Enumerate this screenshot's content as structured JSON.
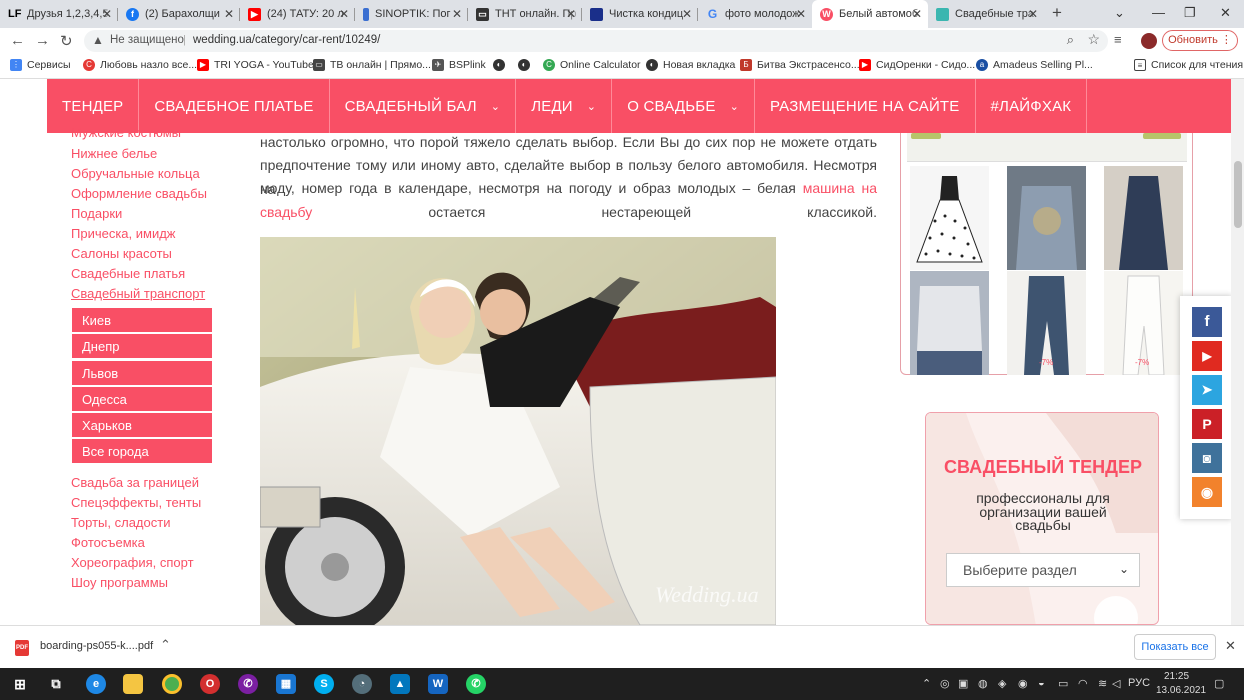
{
  "browser": {
    "tabs": [
      {
        "label": "Друзья 1,2,3,4,5",
        "icon": "LF",
        "color": "#000000"
      },
      {
        "label": "(2) Барахолщи",
        "icon": "facebook-icon",
        "color": "#1877f2"
      },
      {
        "label": "(24) ТАТУ: 20 л",
        "icon": "youtube-icon",
        "color": "#ff0000"
      },
      {
        "label": "SINOPTIK: Пог",
        "icon": "sinoptik-icon",
        "color": "#3b6fd1"
      },
      {
        "label": "ТНТ онлайн. Пр",
        "icon": "tv-icon",
        "color": "#333333"
      },
      {
        "label": "Чистка кондиц",
        "icon": "site-icon",
        "color": "#1a2f8a"
      },
      {
        "label": "фото молодож",
        "icon": "google-icon",
        "color": "#4285f4"
      },
      {
        "label": "Белый автомоб",
        "icon": "wedding-icon",
        "color": "#f94f65"
      },
      {
        "label": "Свадебные тра",
        "icon": "site-icon",
        "color": "#3bb6b0"
      }
    ],
    "new_tab": "+",
    "not_secure": "Не защищено",
    "url": "wedding.ua/category/car-rent/10249/",
    "update_button": "Обновить"
  },
  "bookmarks": [
    {
      "label": "Сервисы",
      "color": "#4285f4"
    },
    {
      "label": "Любовь назло все...",
      "color": "#e53935"
    },
    {
      "label": "TRI YOGA - YouTube",
      "color": "#ff0000"
    },
    {
      "label": "ТВ онлайн | Прямо...",
      "color": "#444444"
    },
    {
      "label": "BSPlink",
      "color": "#555555"
    },
    {
      "label": "",
      "color": "#333333"
    },
    {
      "label": "",
      "color": "#333333"
    },
    {
      "label": "Online Calculator",
      "color": "#34a853"
    },
    {
      "label": "Новая вкладка",
      "color": "#333333"
    },
    {
      "label": "Битва Экстрасенсо...",
      "color": "#c0392b"
    },
    {
      "label": "СидОренки - Сидо...",
      "color": "#ff0000"
    },
    {
      "label": "Amadeus Selling Pl...",
      "color": "#1a4fa3"
    },
    {
      "label": "Список для чтения",
      "color": "#444444"
    }
  ],
  "site": {
    "accent": "#f94f65",
    "nav": [
      {
        "label": "ТЕНДЕР",
        "dropdown": false
      },
      {
        "label": "СВАДЕБНОЕ ПЛАТЬЕ",
        "dropdown": false
      },
      {
        "label": "СВАДЕБНЫЙ БАЛ",
        "dropdown": true
      },
      {
        "label": "ЛЕДИ",
        "dropdown": true
      },
      {
        "label": "О СВАДЬБЕ",
        "dropdown": true
      },
      {
        "label": "РАЗМЕЩЕНИЕ НА САЙТЕ",
        "dropdown": false
      },
      {
        "label": "#ЛАЙФХАК",
        "dropdown": false
      }
    ],
    "sidebar_top": [
      "Мужские костюмы",
      "Нижнее белье",
      "Обручальные кольца",
      "Оформление свадьбы",
      "Подарки",
      "Прическа, имидж",
      "Салоны красоты",
      "Свадебные платья",
      "Свадебный транспорт"
    ],
    "cities": [
      "Киев",
      "Днепр",
      "Львов",
      "Одесса",
      "Харьков",
      "Все города"
    ],
    "sidebar_bottom": [
      "Свадьба за границей",
      "Спецэффекты, тенты",
      "Торты, сладости",
      "Фотосъемка",
      "Хореография, спорт",
      "Шоу программы"
    ],
    "article": {
      "line1": "настолько огромно, что порой тяжело сделать выбор. Если Вы до сих пор не можете отдать",
      "line2": "предпочтение тому или иному авто, сделайте выбор в пользу белого автомобиля. Несмотря на",
      "line3_start": "моду, номер года в календаре, несмотря на погоду и образ молодых – белая ",
      "link": "машина на свадьбу",
      "line4_end": " остается нестареющей классикой.",
      "watermark": "Wedding.ua"
    },
    "shop_discounts": [
      "-7%",
      "-7%"
    ],
    "tender": {
      "title": "СВАДЕБНЫЙ ТЕНДЕР",
      "subtitle": "профессионалы для организации вашей свадьбы",
      "select_placeholder": "Выберите раздел"
    },
    "social": [
      {
        "name": "facebook-icon",
        "glyph": "f",
        "color": "#3b5998"
      },
      {
        "name": "youtube-icon",
        "glyph": "▶",
        "color": "#e02a20"
      },
      {
        "name": "telegram-icon",
        "glyph": "➤",
        "color": "#2ca5e0"
      },
      {
        "name": "pinterest-icon",
        "glyph": "P",
        "color": "#cb2027"
      },
      {
        "name": "instagram-icon",
        "glyph": "◙",
        "color": "#3f729b"
      },
      {
        "name": "rss-icon",
        "glyph": "◉",
        "color": "#f2822c"
      }
    ]
  },
  "downloads": {
    "file": "boarding-ps055-k....pdf",
    "show_all": "Показать все"
  },
  "taskbar": {
    "lang": "РУС",
    "time": "21:25",
    "date": "13.06.2021"
  }
}
